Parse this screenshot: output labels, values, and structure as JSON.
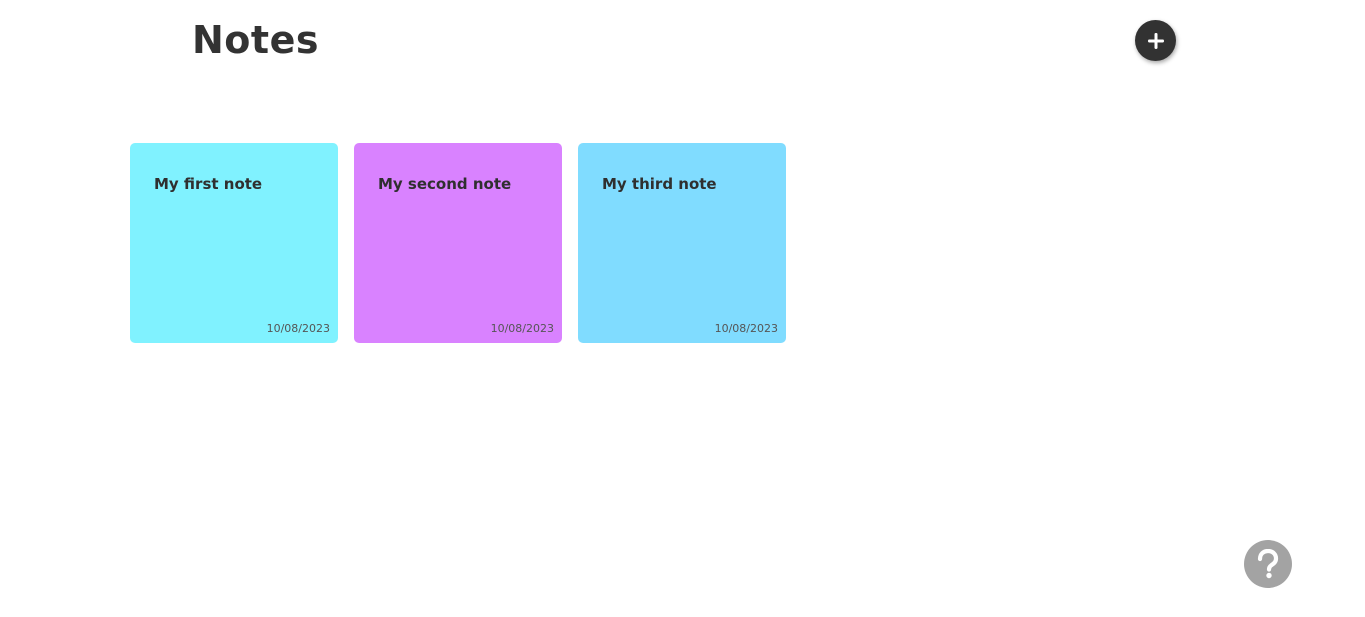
{
  "header": {
    "title": "Notes",
    "add_button_icon": "plus-icon"
  },
  "notes": [
    {
      "title": "My first note",
      "date": "10/08/2023",
      "color": "#80F2FF"
    },
    {
      "title": "My second note",
      "date": "10/08/2023",
      "color": "#D982FF"
    },
    {
      "title": "My third note",
      "date": "10/08/2023",
      "color": "#80DCFF"
    }
  ],
  "help": {
    "icon": "question-mark-icon"
  },
  "colors": {
    "add_button_bg": "#323232",
    "help_button_bg": "#A3A3A3"
  }
}
